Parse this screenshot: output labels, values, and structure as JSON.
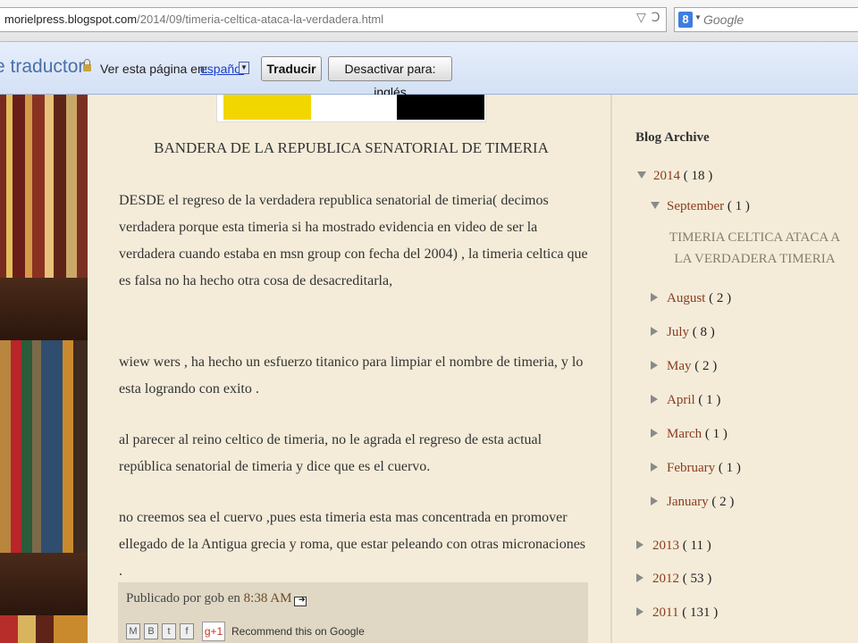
{
  "browser": {
    "url_domain": "morielpress.blogspot.com",
    "url_path": "/2014/09/timeria-celtica-ataca-la-verdadera.html",
    "search_engine_label": "Google",
    "search_icon_letter": "8",
    "reader_icon": "▽",
    "reload_icon": "Ↄ"
  },
  "translate_bar": {
    "logo_text": "e traductor",
    "prompt": "Ver esta página en:",
    "language": "español",
    "translate_button": "Traducir",
    "disable_button": "Desactivar para: inglés"
  },
  "post": {
    "title": "BANDERA DE LA REPUBLICA SENATORIAL DE TIMERIA",
    "paragraphs": [
      "DESDE  el regreso de la verdadera republica senatorial de timeria( decimos verdadera porque esta timeria si ha mostrado evidencia en video de ser la verdadera  cuando  estaba en msn group con fecha del 2004) ,  la timeria celtica que es falsa no ha hecho otra cosa de desacreditarla,",
      "wiew wers  , ha hecho un esfuerzo titanico para limpiar el nombre de timeria, y lo esta logrando con exito .",
      "al parecer al reino celtico de timeria, no le agrada el regreso de esta actual república senatorial de timeria  y dice que es el cuervo.",
      "no creemos sea el cuervo ,pues esta timeria esta mas concentrada en promover ellegado de la Antigua grecia y roma, que estar peleando con otras micronaciones ."
    ],
    "footer_prefix": "Publicado por gob en ",
    "footer_time": "8:38 AM",
    "share_labels": [
      "M",
      "B",
      "t",
      "f"
    ],
    "gplus_label": "g+1",
    "recommend_text": "Recommend this on Google"
  },
  "sidebar": {
    "title": "Blog Archive",
    "year_2014": {
      "label": "2014",
      "count": "( 18 )"
    },
    "september": {
      "label": "September",
      "count": "( 1 )"
    },
    "september_post": "TIMERIA CELTICA ATACA A LA VERDADERA TIMERIA",
    "months": [
      {
        "label": "August",
        "count": "( 2 )"
      },
      {
        "label": "July",
        "count": "( 8 )"
      },
      {
        "label": "May",
        "count": "( 2 )"
      },
      {
        "label": "April",
        "count": "( 1 )"
      },
      {
        "label": "March",
        "count": "( 1 )"
      },
      {
        "label": "February",
        "count": "( 1 )"
      },
      {
        "label": "January",
        "count": "( 2 )"
      }
    ],
    "years": [
      {
        "label": "2013",
        "count": "( 11 )"
      },
      {
        "label": "2012",
        "count": "( 53 )"
      },
      {
        "label": "2011",
        "count": "( 131 )"
      }
    ]
  },
  "colors": {
    "page_bg": "#f4ecd9",
    "link": "#8a3c1e",
    "translate_bar": "#dce6f7"
  }
}
